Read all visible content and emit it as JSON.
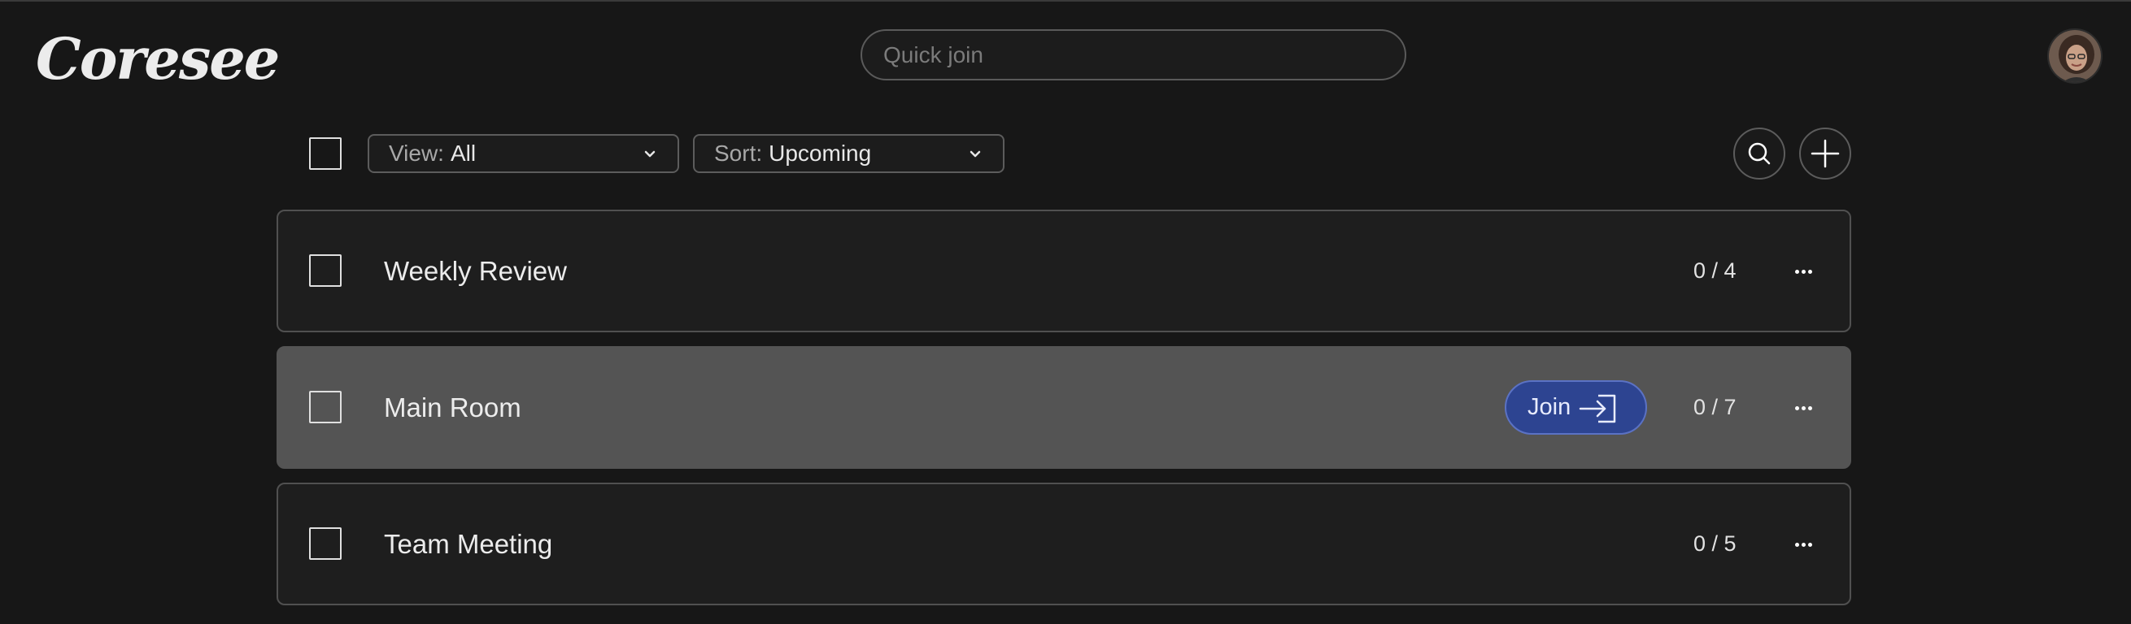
{
  "header": {
    "logo_text": "Coresee",
    "quick_join_placeholder": "Quick join",
    "quick_join_value": ""
  },
  "toolbar": {
    "view_key": "View:",
    "view_value": "All",
    "sort_key": "Sort:",
    "sort_value": "Upcoming"
  },
  "rooms": [
    {
      "name": "Weekly Review",
      "count": "0 / 4",
      "hovered": false
    },
    {
      "name": "Main Room",
      "count": "0 / 7",
      "hovered": true,
      "join_label": "Join"
    },
    {
      "name": "Team Meeting",
      "count": "0 / 5",
      "hovered": false
    }
  ],
  "colors": {
    "background": "#171717",
    "row_hover": "#545454",
    "join_button": "#2d4491"
  },
  "icons": [
    "search-icon",
    "plus-icon",
    "chevron-down-icon",
    "more-icon",
    "enter-icon"
  ]
}
